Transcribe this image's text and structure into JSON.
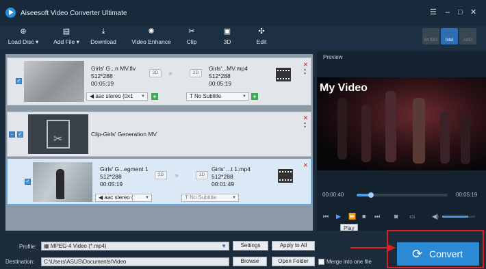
{
  "app": {
    "title": "Aiseesoft Video Converter Ultimate"
  },
  "window_controls": {
    "menu": "☰",
    "minimize": "–",
    "maximize": "□",
    "close": "✕"
  },
  "toolbar": {
    "load_disc": "Load Disc",
    "add_file": "Add File",
    "download": "Download",
    "video_enhance": "Video Enhance",
    "clip": "Clip",
    "three_d": "3D",
    "edit": "Edit",
    "dropdown_arrow": "▾"
  },
  "gpu": {
    "nvidia": "NVIDIA",
    "intel": "Intel",
    "amd": "AMD",
    "active": "Intel"
  },
  "files": {
    "item1": {
      "source_name": "Girls' G...n MV.flv",
      "source_res": "512*288",
      "source_duration": "00:05:19",
      "output_name": "Girls'...MV.mp4",
      "output_res": "512*288",
      "output_duration": "00:05:19",
      "audio": "aac stereo (0x1",
      "subtitle": "No Subtitle",
      "tag": "2D",
      "checked": true
    },
    "group": {
      "name": "Clip-Girls' Generation MV",
      "checked": true
    },
    "item2": {
      "source_name": "Girls' G...egment 1",
      "source_res": "512*288",
      "source_duration": "00:05:19",
      "output_name": "Girls' ...t 1.mp4",
      "output_res": "512*288",
      "output_duration": "00:01:49",
      "audio": "aac stereo (",
      "subtitle": "No Subtitle",
      "tag": "2D",
      "checked": true
    },
    "arrows": "›››"
  },
  "preview": {
    "label": "Preview",
    "video_title": "My Video",
    "current_time": "00:00:40",
    "total_time": "00:05:19",
    "progress": 0.13,
    "volume": 0.8,
    "tooltip": "Play"
  },
  "bottom": {
    "profile_label": "Profile:",
    "profile_value": "MPEG-4 Video (*.mp4)",
    "settings": "Settings",
    "apply_to_all": "Apply to All",
    "destination_label": "Destination:",
    "destination_value": "C:\\Users\\ASUS\\Documents\\Video",
    "browse": "Browse",
    "open_folder": "Open Folder",
    "merge_label": "Merge into one file",
    "merge_checked": false,
    "convert": "Convert"
  },
  "colors": {
    "accent": "#2a8ad6",
    "highlight": "#e02020",
    "background": "#1c2c3c"
  }
}
